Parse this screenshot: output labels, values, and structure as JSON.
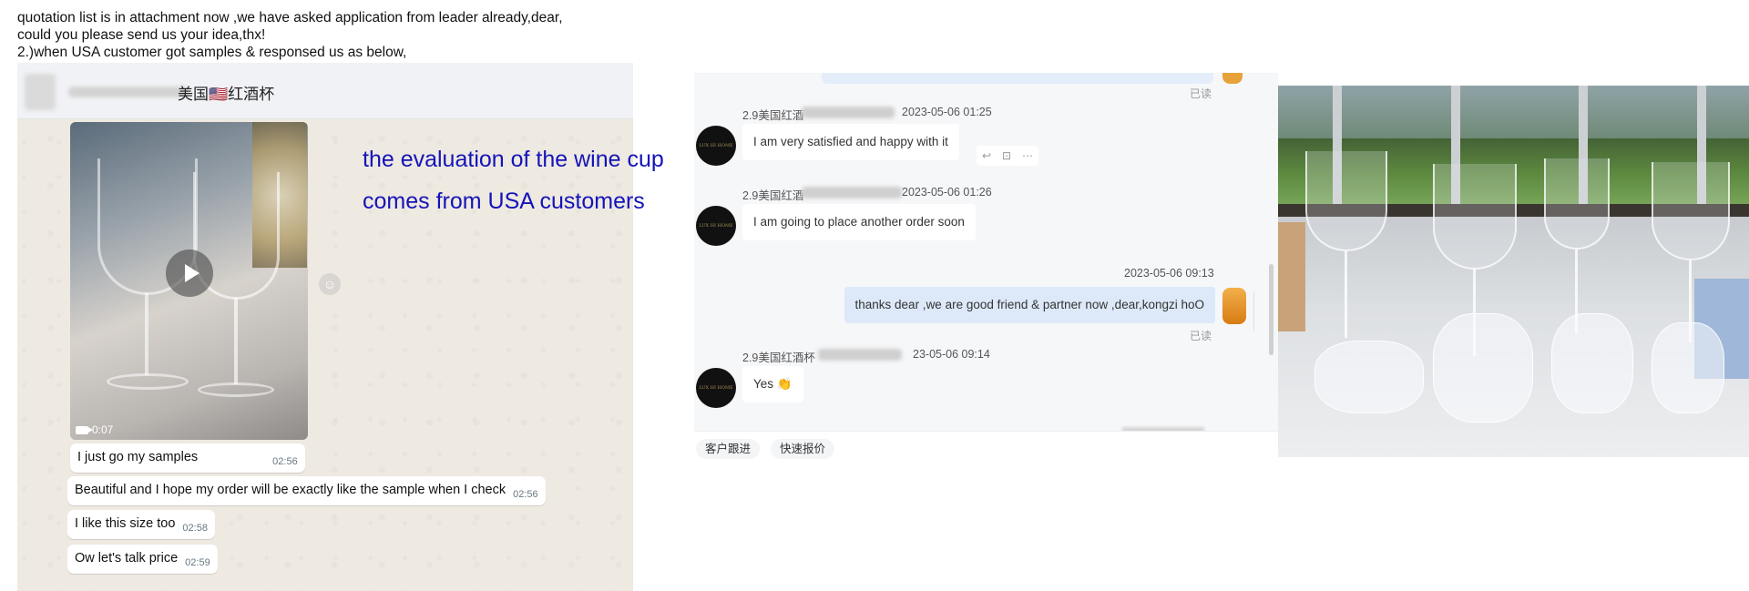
{
  "intro": {
    "line1": "quotation list is in attachment now ,we have asked application from leader already,dear,",
    "line2": "could you please send us your idea,thx!",
    "line3": "2.)when USA customer got samples & responsed us as below,"
  },
  "whatsapp": {
    "chat_title": "美国🇺🇸红酒杯",
    "video_duration": "0:07",
    "messages": [
      {
        "text": "I just go my samples",
        "time": "02:56"
      },
      {
        "text": "Beautiful and I hope my order will be exactly like the sample when I check",
        "time": "02:56"
      },
      {
        "text": "I like this size too",
        "time": "02:58"
      },
      {
        "text": "Ow let's talk price",
        "time": "02:59"
      }
    ]
  },
  "annotation": {
    "line1": "the evaluation of the wine cup",
    "line2": "comes from USA customers"
  },
  "chinese_chat": {
    "read_label": "已读",
    "avatar_text": "LUX HI HOME",
    "messages": [
      {
        "sender": "2.9美国红酒",
        "time": "2023-05-06 01:25",
        "text": "I am very satisfied and happy with it"
      },
      {
        "sender": "2.9美国红酒",
        "time": "2023-05-06 01:26",
        "text": "I am going to place another order soon"
      },
      {
        "sender": "",
        "time": "2023-05-06 09:13",
        "text": "thanks dear ,we are good friend & partner now ,dear,kongzi hoO"
      },
      {
        "sender": "2.9美国红酒杯",
        "time": "23-05-06 09:14",
        "text": "Yes 👏"
      }
    ],
    "bottom_buttons": [
      "客户跟进",
      "快速报价"
    ],
    "actions": [
      "↩",
      "⊡",
      "⋯"
    ]
  },
  "colors": {
    "annotation": "#1414b8",
    "whatsapp_bg": "#eee9e1",
    "my_bubble": "#dde9f9"
  }
}
